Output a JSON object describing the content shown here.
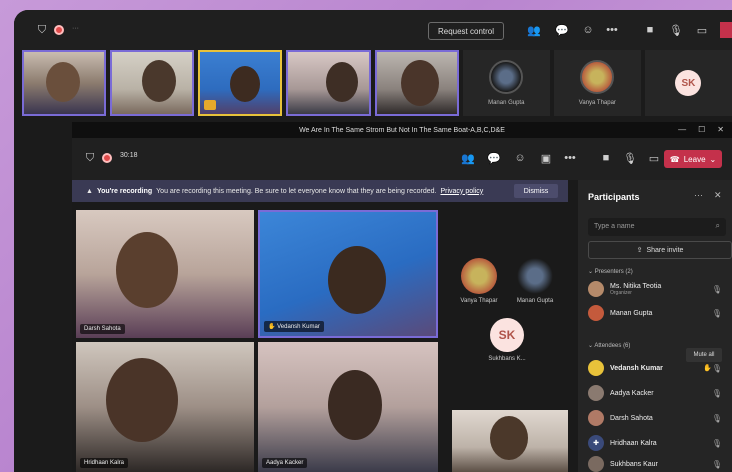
{
  "outer": {
    "request_control": "Request control",
    "avatars": [
      {
        "name": "Manan Gupta"
      },
      {
        "name": "Vanya Thapar"
      }
    ],
    "sk_initials": "SK"
  },
  "inner": {
    "window_title": "We Are In The Same Strom But Not In The Same Boat-A,B,C,D&E",
    "timer": "30:18",
    "leave": "Leave",
    "recording": {
      "bold": "You're recording",
      "text": "You are recording this meeting. Be sure to let everyone know that they are being recorded.",
      "policy": "Privacy policy",
      "dismiss": "Dismiss"
    },
    "tiles": [
      {
        "name": "Darsh Sahota"
      },
      {
        "name": "Vedansh Kumar"
      },
      {
        "name": "Hridhaan Kalra"
      },
      {
        "name": "Aadya Kacker"
      }
    ],
    "right_tiles": [
      {
        "name": "Vanya Thapar"
      },
      {
        "name": "Manan Gupta"
      },
      {
        "name": "Sukhbans K...",
        "initials": "SK"
      }
    ]
  },
  "participants": {
    "title": "Participants",
    "search_placeholder": "Type a name",
    "share_invite": "Share invite",
    "presenters_header": "Presenters (2)",
    "attendees_header": "Attendees (6)",
    "mute_all": "Mute all",
    "presenters": [
      {
        "name": "Ms. Nitika Teotia",
        "role": "Organizer"
      },
      {
        "name": "Manan Gupta",
        "role": ""
      }
    ],
    "attendees": [
      {
        "name": "Vedansh Kumar"
      },
      {
        "name": "Aadya Kacker"
      },
      {
        "name": "Darsh Sahota"
      },
      {
        "name": "Hridhaan Kalra"
      },
      {
        "name": "Sukhbans Kaur"
      }
    ]
  }
}
